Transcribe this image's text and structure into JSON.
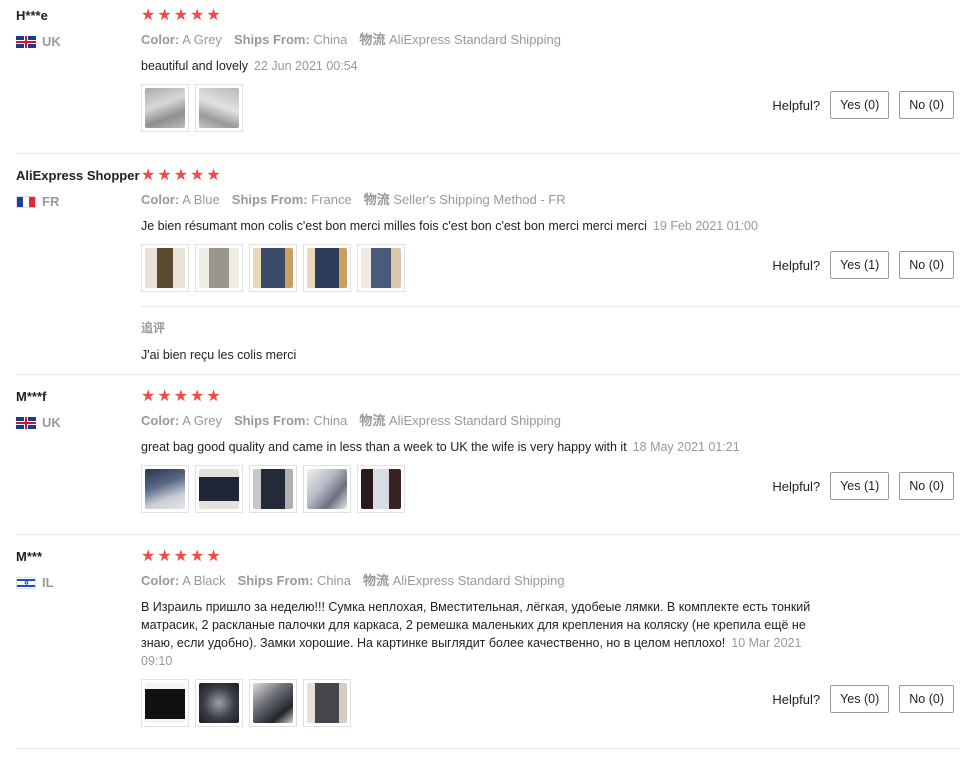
{
  "colors": {
    "star": "#f04a4a",
    "meta": "#999999",
    "border": "#e8e8e8"
  },
  "reviews": [
    {
      "user": "H***e",
      "country": "UK",
      "flag": "uk-flag",
      "stars": "★★★★★",
      "color_label": "Color:",
      "color": "A Grey",
      "ships_label": "Ships From:",
      "ships": "China",
      "shipping_label": "物流",
      "shipping": "AliExpress Standard Shipping",
      "text": "beautiful and lovely",
      "date": "22 Jun 2021 00:54",
      "helpful": "Helpful?",
      "yes": "Yes (0)",
      "no": "No (0)"
    },
    {
      "user": "AliExpress Shopper",
      "country": "FR",
      "flag": "fr-flag",
      "stars": "★★★★★",
      "color_label": "Color:",
      "color": "A Blue",
      "ships_label": "Ships From:",
      "ships": "France",
      "shipping_label": "物流",
      "shipping": "Seller's Shipping Method - FR",
      "text": "Je bien résumant mon colis c'est bon merci milles fois c'est bon c'est bon merci merci merci",
      "date": "19 Feb 2021 01:00",
      "helpful": "Helpful?",
      "yes": "Yes (1)",
      "no": "No (0)",
      "additional_label": "追评",
      "additional_text": "J'ai bien reçu les colis merci"
    },
    {
      "user": "M***f",
      "country": "UK",
      "flag": "uk-flag",
      "stars": "★★★★★",
      "color_label": "Color:",
      "color": "A Grey",
      "ships_label": "Ships From:",
      "ships": "China",
      "shipping_label": "物流",
      "shipping": "AliExpress Standard Shipping",
      "text": "great bag good quality and came in less than a week to UK the wife is very happy with it",
      "date": "18 May 2021 01:21",
      "helpful": "Helpful?",
      "yes": "Yes (1)",
      "no": "No (0)"
    },
    {
      "user": "M***",
      "country": "IL",
      "flag": "il-flag",
      "stars": "★★★★★",
      "color_label": "Color:",
      "color": "A Black",
      "ships_label": "Ships From:",
      "ships": "China",
      "shipping_label": "物流",
      "shipping": "AliExpress Standard Shipping",
      "text": "В Израиль пришло за неделю!!! Сумка неплохая, Вместительная, лёгкая, удобеые лямки. В комплекте есть тонкий матрасик, 2 раскланые палочки для каркаса, 2 ремешка маленьких для крепления на коляску (не крепила ещё не знаю, если удобно). Замки хорошие. На картинке выглядит более качественно, но в целом неплохо!",
      "date": "10 Mar 2021 09:10",
      "helpful": "Helpful?",
      "yes": "Yes (0)",
      "no": "No (0)"
    }
  ]
}
